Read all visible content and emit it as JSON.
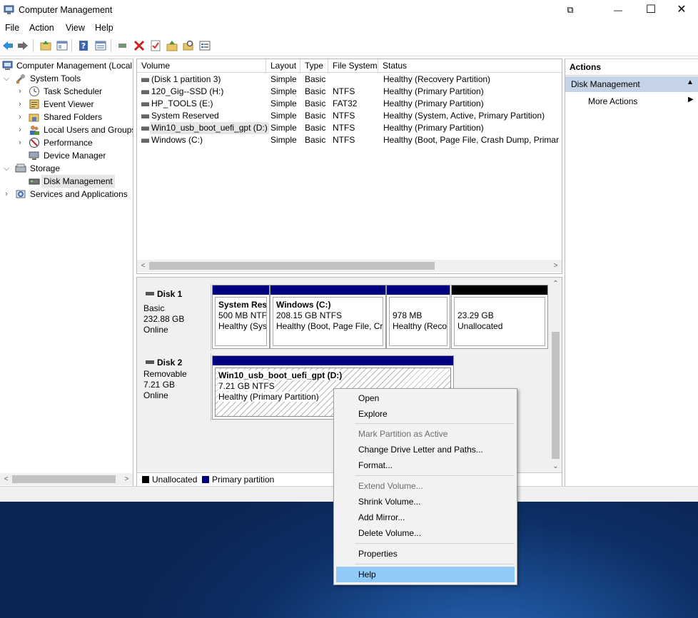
{
  "window": {
    "title": "Computer Management",
    "restore_glyph": "⧉",
    "minimize_glyph": "—",
    "maximize_glyph": "☐",
    "close_glyph": "✕"
  },
  "menubar": [
    "File",
    "Action",
    "View",
    "Help"
  ],
  "tree": {
    "root": "Computer Management (Local",
    "system_tools": "System Tools",
    "task_scheduler": "Task Scheduler",
    "event_viewer": "Event Viewer",
    "shared_folders": "Shared Folders",
    "local_users": "Local Users and Groups",
    "performance": "Performance",
    "device_manager": "Device Manager",
    "storage": "Storage",
    "disk_management": "Disk Management",
    "services": "Services and Applications"
  },
  "volume_list": {
    "columns": [
      "Volume",
      "Layout",
      "Type",
      "File System",
      "Status"
    ],
    "rows": [
      {
        "volume": "(Disk 1 partition 3)",
        "layout": "Simple",
        "type": "Basic",
        "fs": "",
        "status": "Healthy (Recovery Partition)"
      },
      {
        "volume": "120_Gig--SSD (H:)",
        "layout": "Simple",
        "type": "Basic",
        "fs": "NTFS",
        "status": "Healthy (Primary Partition)"
      },
      {
        "volume": "HP_TOOLS (E:)",
        "layout": "Simple",
        "type": "Basic",
        "fs": "FAT32",
        "status": "Healthy (Primary Partition)"
      },
      {
        "volume": "System Reserved",
        "layout": "Simple",
        "type": "Basic",
        "fs": "NTFS",
        "status": "Healthy (System, Active, Primary Partition)"
      },
      {
        "volume": "Win10_usb_boot_uefi_gpt (D:)",
        "layout": "Simple",
        "type": "Basic",
        "fs": "NTFS",
        "status": "Healthy (Primary Partition)"
      },
      {
        "volume": "Windows (C:)",
        "layout": "Simple",
        "type": "Basic",
        "fs": "NTFS",
        "status": "Healthy (Boot, Page File, Crash Dump, Primary"
      }
    ]
  },
  "disks": {
    "disk1": {
      "name": "Disk 1",
      "type": "Basic",
      "size": "232.88 GB",
      "state": "Online",
      "p1": {
        "name": "System Rese",
        "size": "500 MB NTFS",
        "status": "Healthy (Syst"
      },
      "p2": {
        "name": "Windows  (C:)",
        "size": "208.15 GB NTFS",
        "status": "Healthy (Boot, Page File, Cra"
      },
      "p3": {
        "size": "978 MB",
        "status": "Healthy (Reco"
      },
      "p4": {
        "size": "23.29 GB",
        "status": "Unallocated"
      }
    },
    "disk2": {
      "name": "Disk 2",
      "type": "Removable",
      "size": "7.21 GB",
      "state": "Online",
      "p1": {
        "name": "Win10_usb_boot_uefi_gpt  (D:)",
        "size": "7.21 GB NTFS",
        "status": "Healthy (Primary Partition)"
      }
    }
  },
  "legend": {
    "unallocated": "Unallocated",
    "primary": "Primary partition"
  },
  "actions": {
    "header": "Actions",
    "section": "Disk Management",
    "more": "More Actions"
  },
  "context_menu": {
    "open": "Open",
    "explore": "Explore",
    "mark_active": "Mark Partition as Active",
    "change_letter": "Change Drive Letter and Paths...",
    "format": "Format...",
    "extend": "Extend Volume...",
    "shrink": "Shrink Volume...",
    "add_mirror": "Add Mirror...",
    "delete": "Delete Volume...",
    "properties": "Properties",
    "help": "Help"
  },
  "colors": {
    "primary_partition": "#00007f",
    "unallocated": "#000000",
    "menu_highlight": "#91c9f7",
    "actions_section": "#c4d3e6"
  }
}
